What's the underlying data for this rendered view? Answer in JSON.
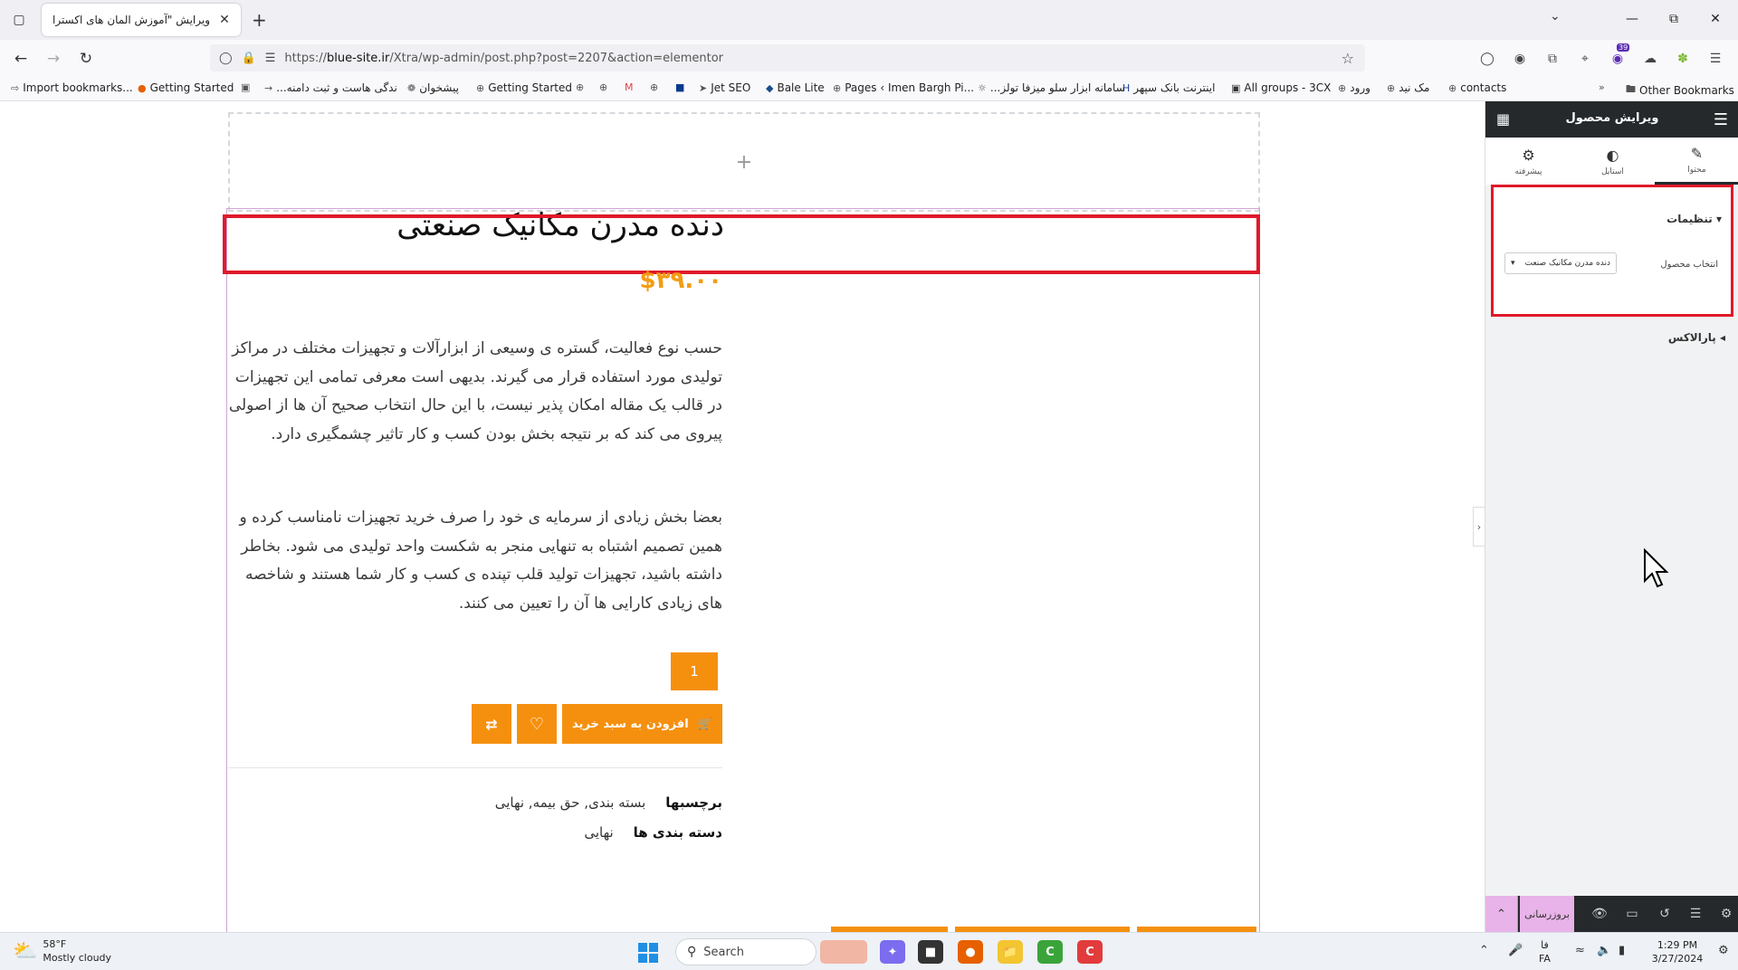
{
  "browser": {
    "tab_title": "ویرایش \"آموزش المان های اکسترا",
    "url_prefix": "https://",
    "url_domain": "blue-site.ir",
    "url_path": "/Xtra/wp-admin/post.php?post=2207&action=elementor",
    "extension_badge": "39"
  },
  "bookmarks": [
    "Import bookmarks...",
    "Getting Started",
    "...ندگی هاست و ثبت دامنه",
    "پیشخوان",
    "Getting Started",
    "Jet SEO",
    "Bale Lite",
    "Pages ‹ Imen Bargh Pi...",
    "...سامانه ابزار سلو میزفا تولز",
    "اینترنت بانک سپهر",
    "All groups - 3CX",
    "ورود",
    "مک نید",
    "contacts"
  ],
  "other_bookmarks": "Other Bookmarks",
  "product": {
    "title": "دنده مدرن مکانیک صنعتی",
    "price": "$۳۹.۰۰",
    "description_1": "حسب نوع فعالیت، گستره ی وسیعی از ابزارآلات و تجهیزات مختلف در مراکز تولیدی مورد استفاده قرار می گیرند. بدیهی است معرفی تمامی این تجهیزات در قالب یک مقاله امکان پذیر نیست، با این حال انتخاب صحیح آن ها از اصولی پیروی می کند که بر نتیجه بخش بودن کسب و کار تاثیر چشمگیری دارد.",
    "description_2": "بعضا بخش زیادی از سرمایه ی خود را صرف خرید تجهیزات نامناسب کرده و همین تصمیم اشتباه به تنهایی منجر به شکست واحد تولیدی می شود. بخاطر داشته باشید، تجهیزات تولید قلب تپنده ی کسب و کار شما هستند و شاخصه های زیادی کارایی ها آن را تعیین می کنند.",
    "quantity": "1",
    "add_to_cart": "افزودن به سبد خرید",
    "tags_label": "برچسبها",
    "tags_value": "بسته بندی, حق بیمه, نهایی",
    "categories_label": "دسته بندی ها",
    "categories_value": "نهایی"
  },
  "panel": {
    "title": "ویرایش محصول",
    "tabs": [
      "محتوا",
      "استایل",
      "پیشرفته"
    ],
    "settings_heading": "تنظیمات",
    "select_label": "انتخاب محصول",
    "select_value": "دنده مدرن مکانیک صنعت",
    "parallax_heading": "پارالاکس",
    "update_label": "بروزرسانی"
  },
  "taskbar": {
    "temperature": "58°F",
    "weather": "Mostly cloudy",
    "search_label": "Search",
    "lang_top": "فا",
    "lang_bottom": "FA",
    "time": "1:29 PM",
    "date": "3/27/2024"
  },
  "colors": {
    "accent_orange": "#f5900f",
    "highlight_red": "#e0192a",
    "panel_dark": "#26292c",
    "update_pink": "#e8b3e8"
  }
}
